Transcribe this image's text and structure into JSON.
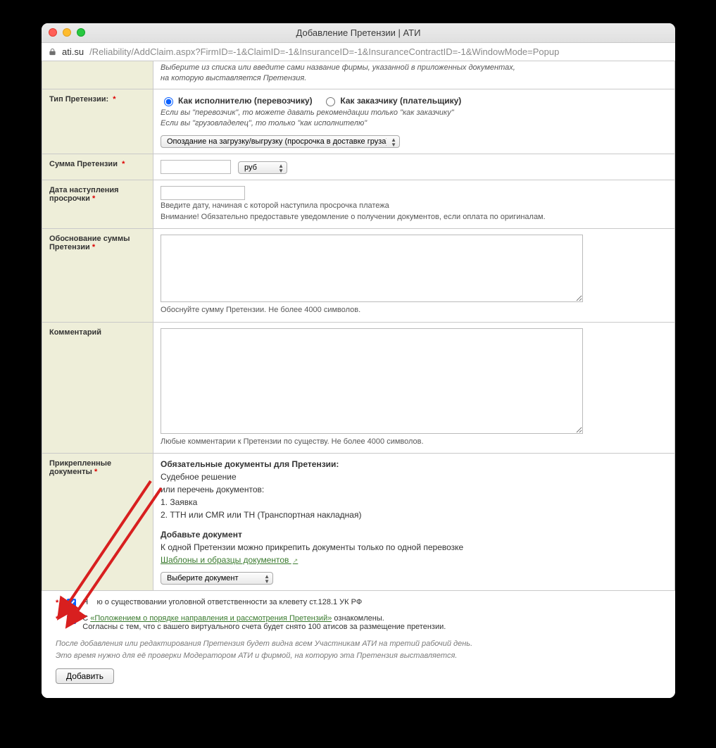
{
  "window": {
    "title": "Добавление Претензии | АТИ",
    "url_host": "ati.su",
    "url_path": "/Reliability/AddClaim.aspx?FirmID=-1&ClaimID=-1&InsuranceID=-1&InsuranceContractID=-1&WindowMode=Popup"
  },
  "rows": {
    "firm_hint1": "Выберите из списка или введите сами название фирмы, указанной в приложенных документах,",
    "firm_hint2": "на которую выставляется Претензия.",
    "type_label": "Тип Претензии:",
    "type_radio1": "Как исполнителю (перевозчику)",
    "type_radio2": "Как заказчику (плательщику)",
    "type_hint1": "Если вы \"перевозчик\", то можете давать рекомендации только \"как заказчику\"",
    "type_hint2": "Если вы \"грузовладелец\", то только \"как исполнителю\"",
    "type_select": "Опоздание на загрузку/выгрузку (просрочка в доставке груза)",
    "sum_label": "Сумма Претензии",
    "currency": "руб",
    "date_label_l1": "Дата наступления",
    "date_label_l2": "просрочки",
    "date_hint1": "Введите дату, начиная с которой наступила просрочка платежа",
    "date_hint2": "Внимание! Обязательно предоставьте уведомление о получении документов, если оплата по оригиналам.",
    "reason_label_l1": "Обоснование суммы",
    "reason_label_l2": "Претензии",
    "reason_hint": "Обоснуйте сумму Претензии. Не более 4000 символов.",
    "comment_label": "Комментарий",
    "comment_hint": "Любые комментарии к Претензии по существу. Не более 4000 символов.",
    "docs_label_l1": "Прикрепленные",
    "docs_label_l2": "документы",
    "docs_heading": "Обязательные документы для Претензии:",
    "docs_line1": "Судебное решение",
    "docs_line2": "или перечень документов:",
    "docs_line3": "1. Заявка",
    "docs_line4": "2. ТТН или CMR или ТН (Транспортная накладная)",
    "docs_add_heading": "Добавьте документ",
    "docs_add_hint": "К одной Претензии можно прикрепить документы только по одной перевозке",
    "docs_templates_link": "Шаблоны и образцы документов ",
    "docs_select": "Выберите документ"
  },
  "checks": {
    "chk1_prefix": "Я ",
    "chk1_mid": "ю о существовании уголовной ответственности за клевету ст.128.1 УК РФ",
    "chk2_prefix": "С ",
    "chk2_link": "«Положением о порядке направления и рассмотрения Претензий»",
    "chk2_suffix": " ознакомлены.",
    "chk2_line2": "Согласны с тем, что с вашего виртуального счета будет снято 100 атисов за размещение претензии."
  },
  "footer": {
    "note1": "После добавления или редактирования Претензия будет видна всем Участникам АТИ на третий рабочий день.",
    "note2": "Это время нужно для её проверки Модератором АТИ и фирмой, на которую эта Претензия выставляется.",
    "submit": "Добавить"
  }
}
